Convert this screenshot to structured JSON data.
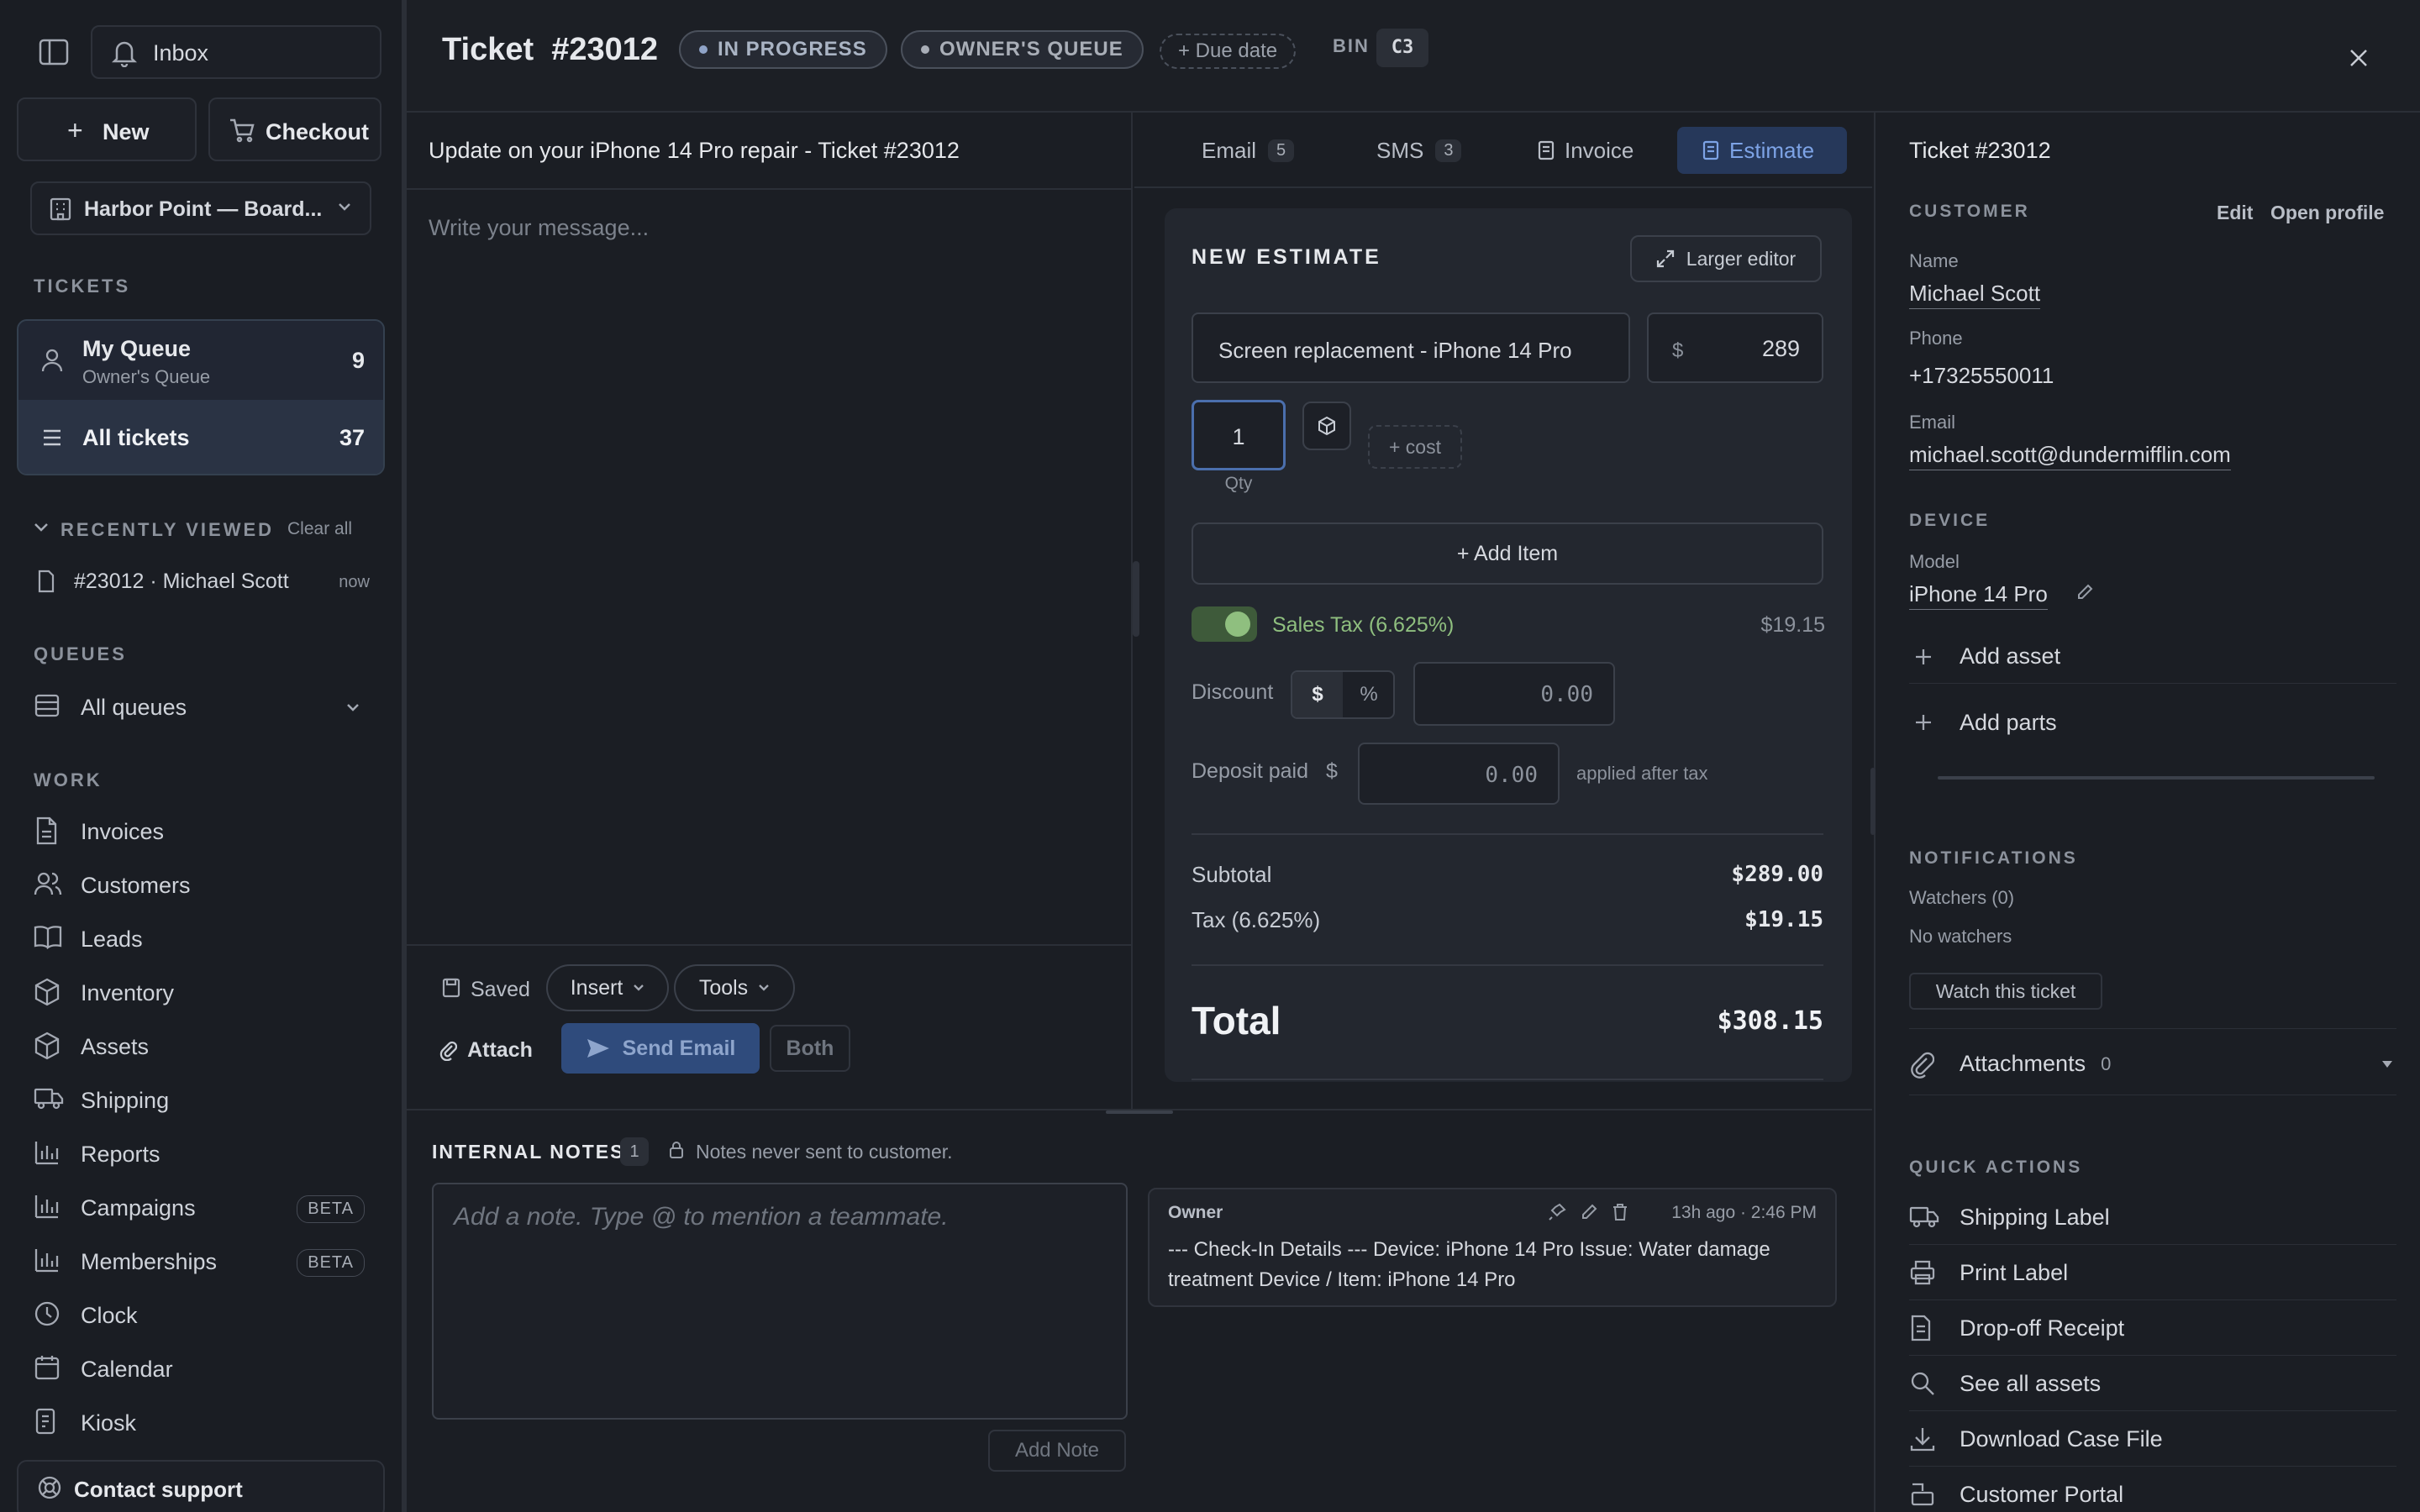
{
  "sidebar": {
    "inbox_label": "Inbox",
    "new_label": "New",
    "checkout_label": "Checkout",
    "location": "Harbor Point — Board...",
    "tickets_heading": "TICKETS",
    "my_queue": {
      "label": "My Queue",
      "sub": "Owner's Queue",
      "count": "9"
    },
    "all_tickets": {
      "label": "All tickets",
      "count": "37"
    },
    "recently_viewed_heading": "RECENTLY VIEWED",
    "clear_all": "Clear all",
    "recent_item": {
      "label": "#23012 · Michael Scott",
      "time": "now"
    },
    "queues_heading": "QUEUES",
    "all_queues": "All queues",
    "work_heading": "WORK",
    "work_items": [
      {
        "label": "Invoices",
        "icon": "file-icon"
      },
      {
        "label": "Customers",
        "icon": "users-icon"
      },
      {
        "label": "Leads",
        "icon": "book-icon"
      },
      {
        "label": "Inventory",
        "icon": "box-icon"
      },
      {
        "label": "Assets",
        "icon": "box-icon"
      },
      {
        "label": "Shipping",
        "icon": "truck-icon"
      },
      {
        "label": "Reports",
        "icon": "bar-chart-icon"
      },
      {
        "label": "Campaigns",
        "icon": "bar-chart-icon",
        "badge": "BETA"
      },
      {
        "label": "Memberships",
        "icon": "bar-chart-icon",
        "badge": "BETA"
      },
      {
        "label": "Clock",
        "icon": "clock-icon"
      },
      {
        "label": "Calendar",
        "icon": "calendar-icon"
      },
      {
        "label": "Kiosk",
        "icon": "tablet-icon"
      }
    ],
    "contact_support": "Contact support"
  },
  "header": {
    "title": "Ticket  #23012",
    "status": "IN PROGRESS",
    "queue": "OWNER'S QUEUE",
    "due_date": "+ Due date",
    "bin_label": "BIN",
    "bin_value": "C3"
  },
  "compose": {
    "subject": "Update on your iPhone 14 Pro repair - Ticket #23012",
    "placeholder": "Write your message...",
    "saved_label": "Saved",
    "insert_label": "Insert",
    "tools_label": "Tools",
    "attach_label": "Attach",
    "send_label": "Send Email",
    "both_label": "Both"
  },
  "tabs": [
    {
      "label": "Email",
      "count": "5"
    },
    {
      "label": "SMS",
      "count": "3"
    },
    {
      "label": "Invoice",
      "count": ""
    },
    {
      "label": "Estimate",
      "count": ""
    }
  ],
  "estimate": {
    "heading": "NEW ESTIMATE",
    "larger_editor": "Larger editor",
    "item_name": "Screen replacement - iPhone 14 Pro",
    "currency": "$",
    "price": "289",
    "qty": "1",
    "qty_label": "Qty",
    "cost_label": "+ cost",
    "add_item": "+ Add Item",
    "sales_tax_label": "Sales Tax (6.625%)",
    "sales_tax_value": "$19.15",
    "discount_label": "Discount",
    "discount_dollar": "$",
    "discount_percent": "%",
    "discount_value": "0.00",
    "deposit_label": "Deposit paid",
    "deposit_currency": "$",
    "deposit_value": "0.00",
    "deposit_note": "applied after tax",
    "subtotal_label": "Subtotal",
    "subtotal_value": "$289.00",
    "tax_label": "Tax (6.625%)",
    "tax_value": "$19.15",
    "total_label": "Total",
    "total_value": "$308.15"
  },
  "notes": {
    "heading": "INTERNAL NOTES",
    "count": "1",
    "privacy": "Notes never sent to customer.",
    "placeholder": "Add a note. Type @ to mention a teammate.",
    "add_note": "Add Note",
    "note": {
      "author": "Owner",
      "time": "13h ago · 2:46 PM",
      "text": "--- Check-In Details --- Device: iPhone 14 Pro Issue: Water damage treatment Device / Item: iPhone 14 Pro"
    }
  },
  "right": {
    "ticket_title": "Ticket #23012",
    "customer_heading": "CUSTOMER",
    "edit_label": "Edit",
    "open_profile": "Open profile",
    "name_label": "Name",
    "name_value": "Michael Scott",
    "phone_label": "Phone",
    "phone_value": "+17325550011",
    "email_label": "Email",
    "email_value": "michael.scott@dundermifflin.com",
    "device_heading": "DEVICE",
    "model_label": "Model",
    "model_value": "iPhone 14 Pro",
    "add_asset": "Add asset",
    "add_parts": "Add parts",
    "notifications_heading": "NOTIFICATIONS",
    "watchers_label": "Watchers (0)",
    "no_watchers": "No watchers",
    "watch_button": "Watch this ticket",
    "attachments_label": "Attachments",
    "attachments_count": "0",
    "quick_actions_heading": "QUICK ACTIONS",
    "quick_actions": [
      {
        "label": "Shipping Label",
        "icon": "truck-icon"
      },
      {
        "label": "Print Label",
        "icon": "printer-icon"
      },
      {
        "label": "Drop-off Receipt",
        "icon": "receipt-icon"
      },
      {
        "label": "See all assets",
        "icon": "search-icon"
      },
      {
        "label": "Download Case File",
        "icon": "download-icon"
      },
      {
        "label": "Customer Portal",
        "icon": "link-icon"
      }
    ]
  },
  "colors": {
    "accent": "#7da3e6",
    "accent_bg": "#26385a",
    "toggle_green": "#8fbf7f",
    "send_button": "#2f4b7c"
  }
}
